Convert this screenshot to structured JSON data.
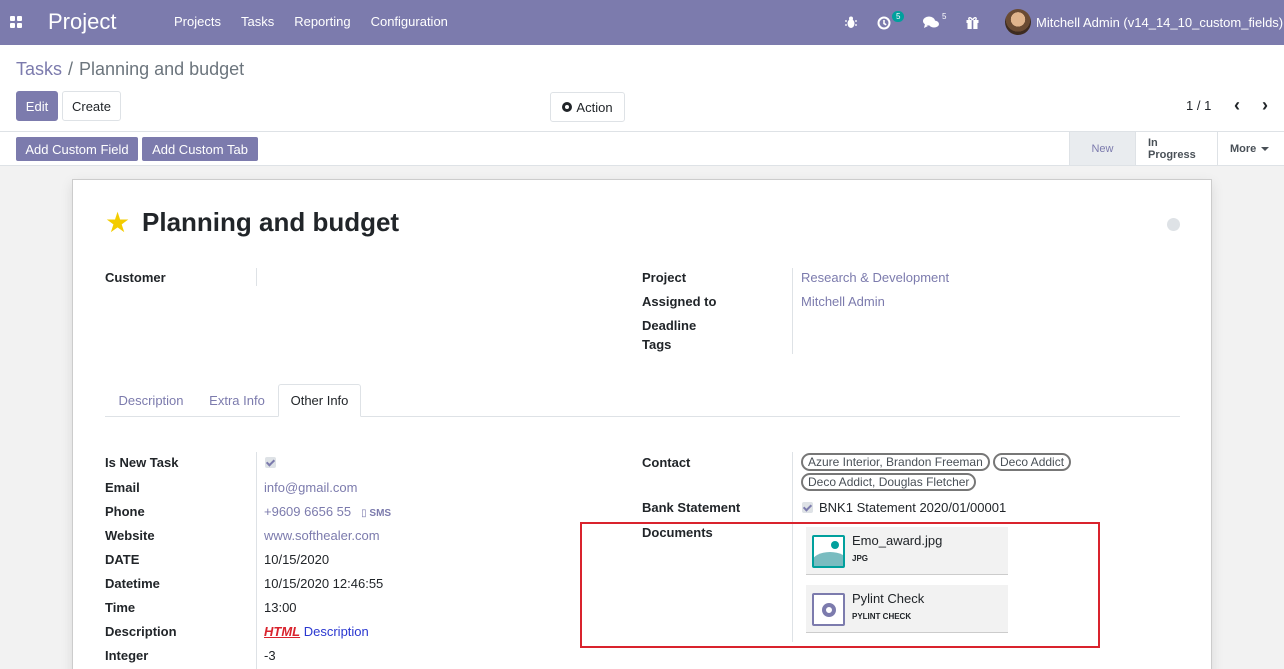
{
  "navbar": {
    "brand": "Project",
    "menu": [
      "Projects",
      "Tasks",
      "Reporting",
      "Configuration"
    ],
    "activity_count": "5",
    "message_count": "5",
    "user_name": "Mitchell Admin (v14_14_10_custom_fields)"
  },
  "breadcrumb": {
    "parent": "Tasks",
    "separator": "/",
    "current": "Planning and budget"
  },
  "toolbar": {
    "edit_label": "Edit",
    "create_label": "Create",
    "action_label": "Action"
  },
  "pager": {
    "value": "1 / 1",
    "prev": "‹",
    "next": "›"
  },
  "header": {
    "add_custom_field": "Add Custom Field",
    "add_custom_tab": "Add Custom Tab",
    "stages": [
      "New",
      "In Progress",
      "More"
    ]
  },
  "record": {
    "title": "Planning and budget",
    "customer_label": "Customer",
    "project_label": "Project",
    "project_value": "Research & Development",
    "assigned_label": "Assigned to",
    "assigned_value": "Mitchell Admin",
    "deadline_label": "Deadline",
    "tags_label": "Tags"
  },
  "tabs": [
    "Description",
    "Extra Info",
    "Other Info"
  ],
  "other_info": {
    "left": [
      {
        "label": "Is New Task"
      },
      {
        "label": "Email",
        "value": "info@gmail.com"
      },
      {
        "label": "Phone",
        "value": "+9609 6656 55",
        "extra": "SMS"
      },
      {
        "label": "Website",
        "value": "www.softhealer.com"
      },
      {
        "label": "DATE",
        "value": "10/15/2020"
      },
      {
        "label": "Datetime",
        "value": "10/15/2020 12:46:55"
      },
      {
        "label": "Time",
        "value": "13:00"
      },
      {
        "label": "Description",
        "value_html": "HTML",
        "value_rest": "Description"
      },
      {
        "label": "Integer",
        "value": "-3"
      }
    ],
    "contact_label": "Contact",
    "contacts": [
      "Azure Interior, Brandon Freeman",
      "Deco Addict",
      "Deco Addict, Douglas Fletcher"
    ],
    "bank_label": "Bank Statement",
    "bank_value": "BNK1 Statement 2020/01/00001",
    "documents_label": "Documents",
    "documents": [
      {
        "name": "Emo_award.jpg",
        "type": "JPG"
      },
      {
        "name": "Pylint Check",
        "type": "PYLINT CHECK"
      }
    ]
  }
}
